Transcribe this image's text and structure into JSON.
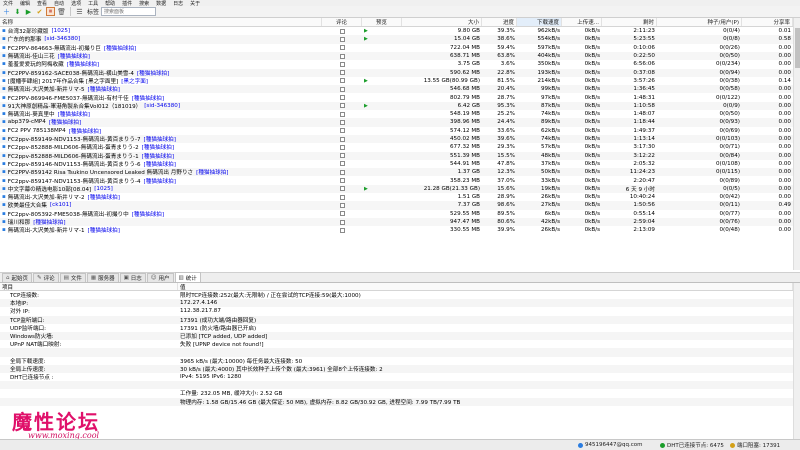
{
  "menu": [
    "文件",
    "编辑",
    "查看",
    "自动",
    "选项",
    "工具",
    "帮助",
    "插件",
    "搜索",
    "数据",
    "日志",
    "关于"
  ],
  "toolbar": {
    "filter_label": "标签",
    "search_placeholder": "搜索面板"
  },
  "columns": {
    "name": "名称",
    "rate": "评论",
    "preview": "预览",
    "size": "大小",
    "progress": "进度",
    "down_speed": "下载速度",
    "up_speed": "上传速...",
    "eta": "剩时",
    "seeds": "种子/用户(P)",
    "ratio": "分享率"
  },
  "torrents": [
    {
      "name": "台湾32部珍藏版",
      "tag": "[1025]",
      "play": true,
      "size": "9.80 GB",
      "progress": "39.3%",
      "down": "962kB/s",
      "up": "0kB/s",
      "eta": "2:11:23",
      "peers": "0(0/4)",
      "ratio": "0.01"
    },
    {
      "name": "广东的的那事",
      "tag": "[sid-346380]",
      "play": true,
      "size": "15.04 GB",
      "progress": "38.6%",
      "down": "554kB/s",
      "up": "0kB/s",
      "eta": "5:23:55",
      "peers": "0(0/8)",
      "ratio": "0.58"
    },
    {
      "name": "FC2PPV-864663-無碼流出-初撮り巨",
      "tag": "[種猫抽球拍]",
      "play": false,
      "size": "722.04 MB",
      "progress": "59.4%",
      "down": "597kB/s",
      "up": "0kB/s",
      "eta": "0:10:06",
      "peers": "0(0/26)",
      "ratio": "0.00"
    },
    {
      "name": "無碼流出-佳山三花",
      "tag": "[種猫抽球拍]",
      "play": false,
      "size": "638.71 MB",
      "progress": "63.8%",
      "down": "404kB/s",
      "up": "0kB/s",
      "eta": "0:22:50",
      "peers": "0(0/50)",
      "ratio": "0.00"
    },
    {
      "name": "羞羞爱爱玩的阿梅收藏",
      "tag": "[種猫抽球拍]",
      "play": false,
      "size": "3.75 GB",
      "progress": "3.6%",
      "down": "350kB/s",
      "up": "0kB/s",
      "eta": "6:56:06",
      "peers": "0(0/234)",
      "ratio": "0.00"
    },
    {
      "name": "FC2PPV-859162-SACE038-無碼流出-横山美雪-4",
      "tag": "[種猫抽球拍]",
      "play": false,
      "size": "590.62 MB",
      "progress": "22.8%",
      "down": "193kB/s",
      "up": "0kB/s",
      "eta": "0:37:08",
      "peers": "0(0/94)",
      "ratio": "0.00"
    },
    {
      "name": "[魔幡李肆組] 2017年作品合集 [黑之字面里]",
      "tag": "[黑之字面]",
      "play": true,
      "size": "13.55 GB(80.99 GB)",
      "progress": "81.5%",
      "down": "214kB/s",
      "up": "0kB/s",
      "eta": "3:57:26",
      "peers": "0(0/38)",
      "ratio": "0.14"
    },
    {
      "name": "無碼流出-大沢美加-新井リマ-5",
      "tag": "[種猫抽球拍]",
      "play": false,
      "size": "546.68 MB",
      "progress": "20.4%",
      "down": "99kB/s",
      "up": "0kB/s",
      "eta": "1:36:45",
      "peers": "0(0/58)",
      "ratio": "0.00"
    },
    {
      "name": "FC2PPV-869946-FME5037-無碼流出-有村千佳",
      "tag": "[種猫抽球拍]",
      "play": false,
      "size": "802.79 MB",
      "progress": "28.7%",
      "down": "97kB/s",
      "up": "0kB/s",
      "eta": "1:48:31",
      "peers": "0(0/122)",
      "ratio": "0.00"
    },
    {
      "name": "91大神原創精品-軍港角製糸合集Vol012（181019）",
      "tag": "[sid-346380]",
      "play": true,
      "size": "6.42 GB",
      "progress": "95.3%",
      "down": "87kB/s",
      "up": "0kB/s",
      "eta": "1:10:58",
      "peers": "0(0/9)",
      "ratio": "0.00"
    },
    {
      "name": "無碼流出-葵真里中",
      "tag": "[種猫抽球拍]",
      "play": false,
      "size": "548.19 MB",
      "progress": "25.2%",
      "down": "74kB/s",
      "up": "0kB/s",
      "eta": "1:48:07",
      "peers": "0(0/50)",
      "ratio": "0.00"
    },
    {
      "name": "abp379-cMP4",
      "tag": "[種猫抽球拍]",
      "play": false,
      "size": "398.96 MB",
      "progress": "24.4%",
      "down": "89kB/s",
      "up": "0kB/s",
      "eta": "1:18:44",
      "peers": "0(0/93)",
      "ratio": "0.00"
    },
    {
      "name": "FC2 PPV 785138MP4",
      "tag": "[種猫抽球拍]",
      "play": false,
      "size": "574.12 MB",
      "progress": "33.6%",
      "down": "62kB/s",
      "up": "0kB/s",
      "eta": "1:49:37",
      "peers": "0(0/69)",
      "ratio": "0.00"
    },
    {
      "name": "FC2ppv-859149-NDV1153-無碼流出-黄百まりう-7",
      "tag": "[種猫抽球拍]",
      "play": false,
      "size": "450.02 MB",
      "progress": "39.6%",
      "down": "74kB/s",
      "up": "0kB/s",
      "eta": "1:13:14",
      "peers": "0(0/103)",
      "ratio": "0.00"
    },
    {
      "name": "FC2ppv-852888-MILD606-無碼流出-蛋青まりう-2",
      "tag": "[種猫抽球拍]",
      "play": false,
      "size": "677.32 MB",
      "progress": "29.3%",
      "down": "57kB/s",
      "up": "0kB/s",
      "eta": "3:17:30",
      "peers": "0(0/71)",
      "ratio": "0.00"
    },
    {
      "name": "FC2ppv-852888-MILD606-無碼流出-蛋青まりう-1",
      "tag": "[種猫抽球拍]",
      "play": false,
      "size": "551.39 MB",
      "progress": "15.5%",
      "down": "48kB/s",
      "up": "0kB/s",
      "eta": "3:12:22",
      "peers": "0(0/84)",
      "ratio": "0.00"
    },
    {
      "name": "FC2ppv-859146-NDV1153-無碼流出-黄百まりう-6",
      "tag": "[種猫抽球拍]",
      "play": false,
      "size": "544.91 MB",
      "progress": "47.8%",
      "down": "37kB/s",
      "up": "0kB/s",
      "eta": "2:05:32",
      "peers": "0(0/108)",
      "ratio": "0.00"
    },
    {
      "name": "FC2PPV-859142 Risa Tsukino Uncensored Leaked 無碼流出 月野りさ",
      "tag": "[種猫抽球拍]",
      "play": false,
      "size": "1.37 GB",
      "progress": "12.3%",
      "down": "50kB/s",
      "up": "0kB/s",
      "eta": "11:24:23",
      "peers": "0(0/115)",
      "ratio": "0.00"
    },
    {
      "name": "FC2ppv-859147-NDV1153-無碼流出-黄百まりう-4",
      "tag": "[種猫抽球拍]",
      "play": false,
      "size": "358.23 MB",
      "progress": "37.0%",
      "down": "33kB/s",
      "up": "0kB/s",
      "eta": "2:20:47",
      "peers": "0(0/89)",
      "ratio": "0.00"
    },
    {
      "name": "中文字幕の精选电影10部[08.04]",
      "tag": "[1025]",
      "play": true,
      "size": "21.28 GB(21.33 GB)",
      "progress": "15.6%",
      "down": "19kB/s",
      "up": "0kB/s",
      "eta": "6 天 9 小时",
      "peers": "0(0/5)",
      "ratio": "0.00"
    },
    {
      "name": "無碼流出-大沢美加-新井リマ-2",
      "tag": "[種猫抽球拍]",
      "play": false,
      "size": "1.51 GB",
      "progress": "28.9%",
      "down": "26kB/s",
      "up": "0kB/s",
      "eta": "10:40:24",
      "peers": "0(0/42)",
      "ratio": "0.00"
    },
    {
      "name": "欧美最佳大合集",
      "tag": "[ck101]",
      "play": false,
      "size": "7.37 GB",
      "progress": "98.6%",
      "down": "27kB/s",
      "up": "0kB/s",
      "eta": "1:50:56",
      "peers": "0(0/11)",
      "ratio": "0.49"
    },
    {
      "name": "FC2ppv-805392-FME5038-無碼流出-初撮り中",
      "tag": "[種猫抽球拍]",
      "play": false,
      "size": "529.55 MB",
      "progress": "89.5%",
      "down": "6kB/s",
      "up": "0kB/s",
      "eta": "0:55:14",
      "peers": "0(0/77)",
      "ratio": "0.00"
    },
    {
      "name": "瑞川和那",
      "tag": "[種猫抽球拍]",
      "play": false,
      "size": "947.47 MB",
      "progress": "80.6%",
      "down": "42kB/s",
      "up": "0kB/s",
      "eta": "2:59:04",
      "peers": "0(0/76)",
      "ratio": "0.00"
    },
    {
      "name": "無碼流出-大沢美加-新井リマ-1",
      "tag": "[種猫抽球拍]",
      "play": false,
      "size": "330.55 MB",
      "progress": "39.9%",
      "down": "26kB/s",
      "up": "0kB/s",
      "eta": "2:13:09",
      "peers": "0(0/48)",
      "ratio": "0.00"
    }
  ],
  "tabs": [
    "起始页",
    "评论",
    "文件",
    "服务器",
    "日志",
    "用户",
    "统计"
  ],
  "stats_header": {
    "item": "项目",
    "value": "值"
  },
  "stats": [
    {
      "label": "TCP连接数:",
      "value": "限时TCP连接数:252(最大:无限制) / 正在尝试的TCP连接:59(最大:1000)"
    },
    {
      "label": "本地IP:",
      "value": "172.27.4.146"
    },
    {
      "label": "对外 IP:",
      "value": "112.38.217.87"
    },
    {
      "label": "TCP监听端口:",
      "value": "17391 (成功大端/路由器回复)"
    },
    {
      "label": "UDP监听端口:",
      "value": "17391 (防火墙/路由器已开启)"
    },
    {
      "label": "Windows防火墙:",
      "value": "已添加 [TCP added, UDP added]"
    },
    {
      "label": "UPnP NAT端口映射:",
      "value": "失败 [UPNP device not found!]"
    },
    {
      "label": "",
      "value": ""
    },
    {
      "label": "全局下载速度:",
      "value": "3965 kB/s (最大:10000)     每任务最大连接数: 50"
    },
    {
      "label": "全局上传速度:",
      "value": "30 kB/s (最大:4000)     其中长效种子上传个数 (最大:3961)     全部8个上传连接数: 2"
    },
    {
      "label": "DHT已连接节点 :",
      "value": "IPv4: 5195  IPv6: 1280"
    },
    {
      "label": "",
      "value": ""
    },
    {
      "label": "",
      "value": "工作量: 232.05 MB, 缓冲大小: 2.52 GB"
    },
    {
      "label": "",
      "value": "物理内存: 1.58 GB/15.46 GB (最大保证: 50 MB), 虚拟内存: 8.82 GB/30.92 GB, 进程空间: 7.99 TB/7.99 TB"
    }
  ],
  "watermark": {
    "title": "魔性论坛",
    "url": "www.moxing.cool"
  },
  "status": {
    "qq": "945196447@qq.com",
    "dht": "DHT已连接节点: 6475",
    "port": "端口阻塞: 17391"
  }
}
